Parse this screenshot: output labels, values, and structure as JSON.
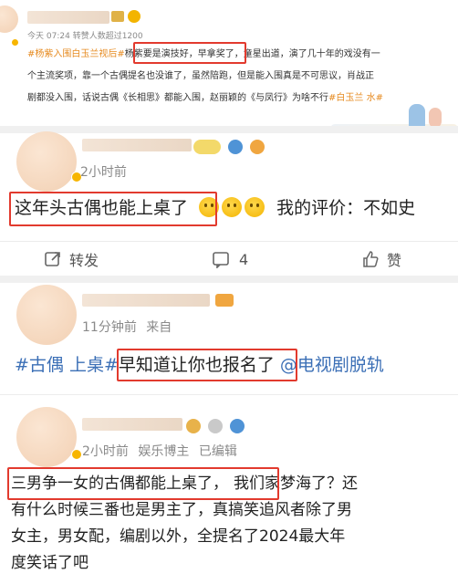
{
  "post": {
    "date": "今天 07:24",
    "reads": "转赞人数超过1200",
    "tag": "#杨紫入围白玉兰视后#",
    "highlight": "杨紫要是演技好，早拿奖了",
    "line1_rest": "，童星出道，演了几十年的戏没有一",
    "line2": "个主流奖项，靠一个古偶提名也没谁了，虽然陪跑，但是能入围真是不可思议，肖战正",
    "line3_a": "剧都没入围，话说古偶《长相思》都能入围，赵丽颖的《与凤行》为啥不行",
    "line3_tag": "#白玉兰",
    "line3_end": " 水#"
  },
  "comments": [
    {
      "time": "2小时前",
      "highlight": "这年头古偶也能上桌了",
      "tail": "我的评价：不如史",
      "actions": {
        "repost": "转发",
        "comment": "4",
        "like": "赞"
      }
    },
    {
      "time": "11分钟前",
      "source": "来自",
      "prefix": "#古偶 上桌#",
      "highlight": "早知道让你也报名了",
      "mention": "@电视剧脱轨"
    },
    {
      "time": "2小时前",
      "role": "娱乐博主",
      "edited": "已编辑",
      "highlight": "三男争一女的古偶都能上桌了，",
      "line1_rest": "我们家梦海了？还",
      "line2": "有什么时候三番也是男主了，真搞笑追风者除了男",
      "line3": "女主，男女配，编剧以外，全提名了2024最大年",
      "line4": "度笑话了吧"
    }
  ],
  "colors": {
    "highlight_border": "#e23a2e",
    "link": "#e68a1f",
    "meta": "#8a8a8a"
  }
}
